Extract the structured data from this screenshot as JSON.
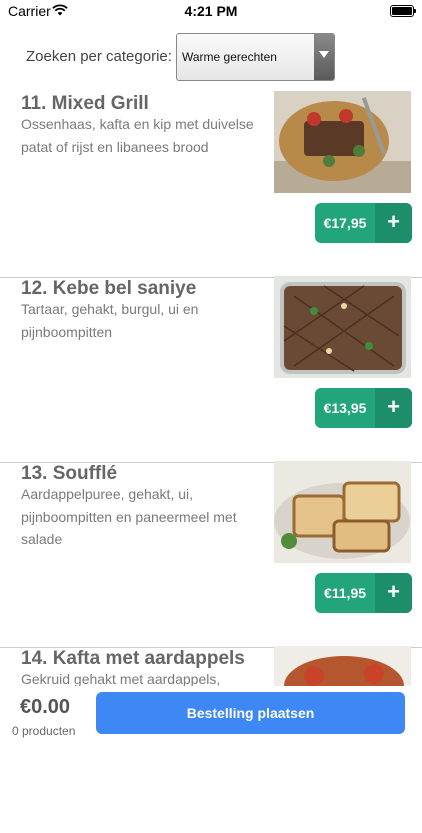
{
  "status_bar": {
    "carrier": "Carrier",
    "time": "4:21 PM"
  },
  "filter": {
    "label": "Zoeken per categorie:",
    "selected": "Warme gerechten"
  },
  "items": [
    {
      "title": "11. Mixed Grill",
      "description": "Ossenhaas, kafta en kip met duivelse patat of rijst en libanees brood",
      "price": "€17,95"
    },
    {
      "title": "12. Kebe bel saniye",
      "description": "Tartaar, gehakt, burgul, ui en pijnboompitten",
      "price": "€13,95"
    },
    {
      "title": "13. Soufflé",
      "description": "Aardappelpuree, gehakt, ui, pijnboompitten en paneermeel met salade",
      "price": "€11,95"
    },
    {
      "title": "14. Kafta met aardappels",
      "description": "Gekruid gehakt met aardappels, tomaat",
      "price": ""
    }
  ],
  "add_label": "+",
  "cart": {
    "total": "€0.00",
    "count": "0 producten",
    "order_label": "Bestelling plaatsen"
  },
  "colors": {
    "accent_green": "#22a57a",
    "order_blue": "#3d88f5"
  }
}
